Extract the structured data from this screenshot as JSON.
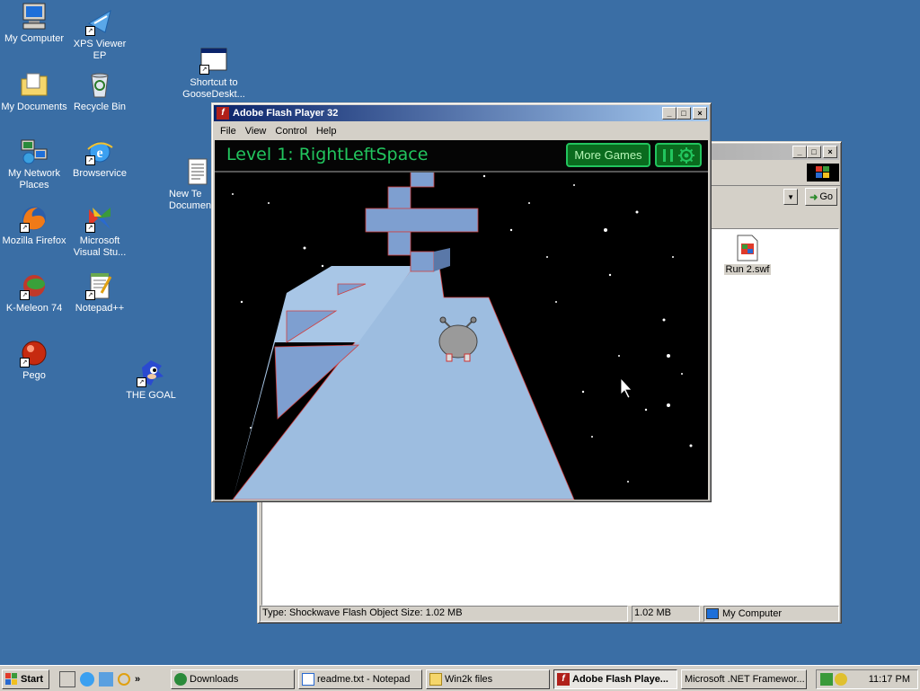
{
  "desktop": {
    "icons": [
      {
        "label": "My Computer",
        "icon": "my-computer-icon"
      },
      {
        "label": "XPS Viewer EP",
        "icon": "xps-viewer-icon"
      },
      {
        "label": "My Documents",
        "icon": "my-documents-icon"
      },
      {
        "label": "Recycle Bin",
        "icon": "recycle-bin-icon"
      },
      {
        "label": "My Network Places",
        "icon": "network-places-icon"
      },
      {
        "label": "Browservice",
        "icon": "browservice-icon"
      },
      {
        "label": "Mozilla Firefox",
        "icon": "firefox-icon"
      },
      {
        "label": "Microsoft Visual Stu...",
        "icon": "visual-studio-icon"
      },
      {
        "label": "K-Meleon 74",
        "icon": "kmeleon-icon"
      },
      {
        "label": "Notepad++",
        "icon": "notepadpp-icon"
      },
      {
        "label": "Pego",
        "icon": "pego-icon"
      },
      {
        "label": "THE GOAL",
        "icon": "sonic-icon"
      },
      {
        "label": "Shortcut to GooseDeskt...",
        "icon": "shortcut-window-icon"
      },
      {
        "label": "New Te Documen",
        "icon": "text-document-icon"
      }
    ]
  },
  "explorer": {
    "go_label": "Go",
    "file_name": "Run 2.swf",
    "status_type": "Type: Shockwave Flash Object Size: 1.02 MB",
    "status_size": "1.02 MB",
    "status_location": "My Computer"
  },
  "flash": {
    "title": "Adobe Flash Player 32",
    "menu": [
      "File",
      "View",
      "Control",
      "Help"
    ],
    "level_title": "Level 1: RightLeftSpace",
    "more_games": "More Games"
  },
  "taskbar": {
    "start": "Start",
    "buttons": [
      {
        "label": "Downloads",
        "active": false
      },
      {
        "label": "readme.txt - Notepad",
        "active": false
      },
      {
        "label": "Win2k files",
        "active": false
      },
      {
        "label": "Adobe Flash Playe...",
        "active": true
      },
      {
        "label": "Microsoft .NET Framewor...",
        "active": false
      }
    ],
    "clock": "11:17 PM"
  },
  "colors": {
    "desktop": "#3a6ea5",
    "title_active": "#0a246a",
    "hud_green": "#22c55e",
    "tunnel": "#9dbde0"
  }
}
